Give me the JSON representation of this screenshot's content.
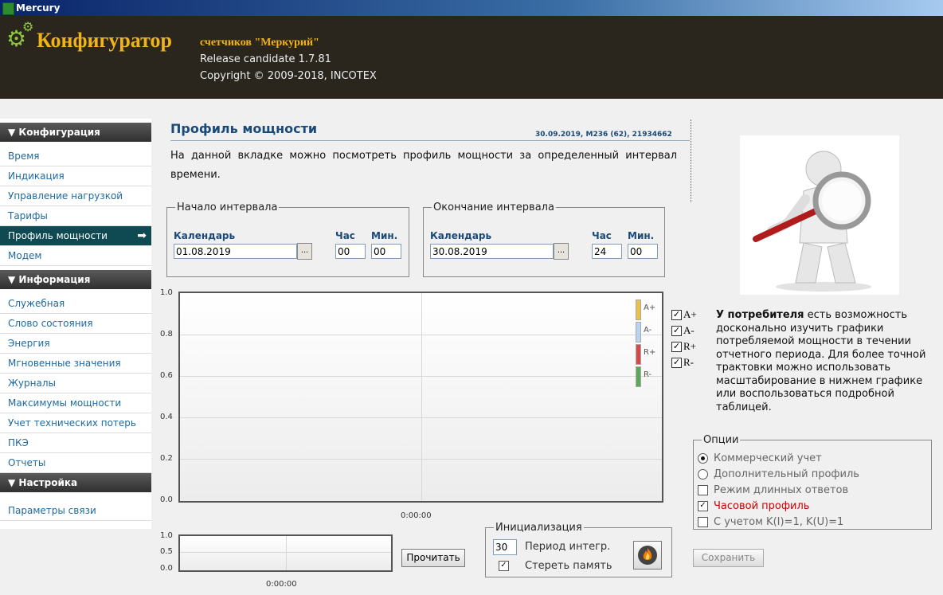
{
  "window": {
    "title": "Mercury"
  },
  "header": {
    "title": "Конфигуратор",
    "subtitle": "счетчиков \"Меркурий\"",
    "release": "Release candidate 1.7.81",
    "copyright": "Copyright © 2009-2018, INCOTEX"
  },
  "sidebar": {
    "sections": [
      {
        "label": "▼ Конфигурация",
        "items": [
          "Время",
          "Индикация",
          "Управление нагрузкой",
          "Тарифы",
          "Профиль мощности",
          "Модем"
        ]
      },
      {
        "label": "▼ Информация",
        "items": [
          "Служебная",
          "Слово состояния",
          "Энергия",
          "Мгновенные значения",
          "Журналы",
          "Максимумы мощности",
          "Учет технических потерь",
          "ПКЭ",
          "Отчеты"
        ]
      },
      {
        "label": "▼ Настройка",
        "items": [
          "Параметры связи"
        ]
      }
    ],
    "active": "Профиль мощности",
    "active_arrow": "➡"
  },
  "page": {
    "title": "Профиль мощности",
    "meta": "30.09.2019, М236 (62), 21934662",
    "description": "На данной вкладке можно посмотреть профиль мощности за определенный интервал времени."
  },
  "interval_start": {
    "legend": "Начало интервала",
    "calendar_label": "Календарь",
    "date": "01.08.2019",
    "hour_label": "Час",
    "min_label": "Мин.",
    "hour": "00",
    "minute": "00",
    "picker": "..."
  },
  "interval_end": {
    "legend": "Окончание интервала",
    "calendar_label": "Календарь",
    "date": "30.08.2019",
    "hour_label": "Час",
    "min_label": "Мин.",
    "hour": "24",
    "minute": "00",
    "picker": "..."
  },
  "chart_data": {
    "type": "line",
    "y_ticks": [
      "1.0",
      "0.8",
      "0.6",
      "0.4",
      "0.2",
      "0.0"
    ],
    "ylim": [
      0,
      1
    ],
    "x_ticks": [
      "0:00:00"
    ],
    "grid": true,
    "legend_position": "top-right",
    "series": [
      {
        "name": "A+",
        "color": "#e8c04a",
        "values": []
      },
      {
        "name": "A-",
        "color": "#b8d4ee",
        "values": []
      },
      {
        "name": "R+",
        "color": "#d24a4a",
        "values": []
      },
      {
        "name": "R-",
        "color": "#5aa85a",
        "values": []
      }
    ]
  },
  "series_toggles": [
    {
      "label": "A+",
      "checked": true,
      "mark": "✓"
    },
    {
      "label": "A-",
      "checked": true,
      "mark": "✓"
    },
    {
      "label": "R+",
      "checked": true,
      "mark": "✓"
    },
    {
      "label": "R-",
      "checked": true,
      "mark": "✓"
    }
  ],
  "mini_chart": {
    "y_ticks": [
      "1.0",
      "0.5",
      "0.0"
    ],
    "x_tick": "0:00:00"
  },
  "read_button": "Прочитать",
  "init": {
    "legend": "Инициализация",
    "period_value": "30",
    "period_label": "Период интегр.",
    "erase_label": "Стереть память",
    "erase_checked": true,
    "erase_mark": "✓"
  },
  "side_info": {
    "bold": "У потребителя",
    "text": " есть возможность досконально изучить графики потребляемой мощности в течении отчетного периода. Для более точной трактовки можно использовать масштабирование в нижнем графике или воспользоваться подробной таблицей."
  },
  "options": {
    "legend": "Опции",
    "commercial": "Коммерческий учет",
    "additional": "Дополнительный профиль",
    "long_answers": "Режим длинных ответов",
    "hourly": "Часовой профиль",
    "with_k": "С учетом K(I)=1, K(U)=1",
    "hourly_mark": "✓",
    "hourly_color": "#cc0000"
  },
  "save_button": "Сохранить",
  "colors": {
    "accent": "#f2b316",
    "header_bg": "#2a261d",
    "active_item": "#0f4a52",
    "link": "#1e6aa0"
  }
}
